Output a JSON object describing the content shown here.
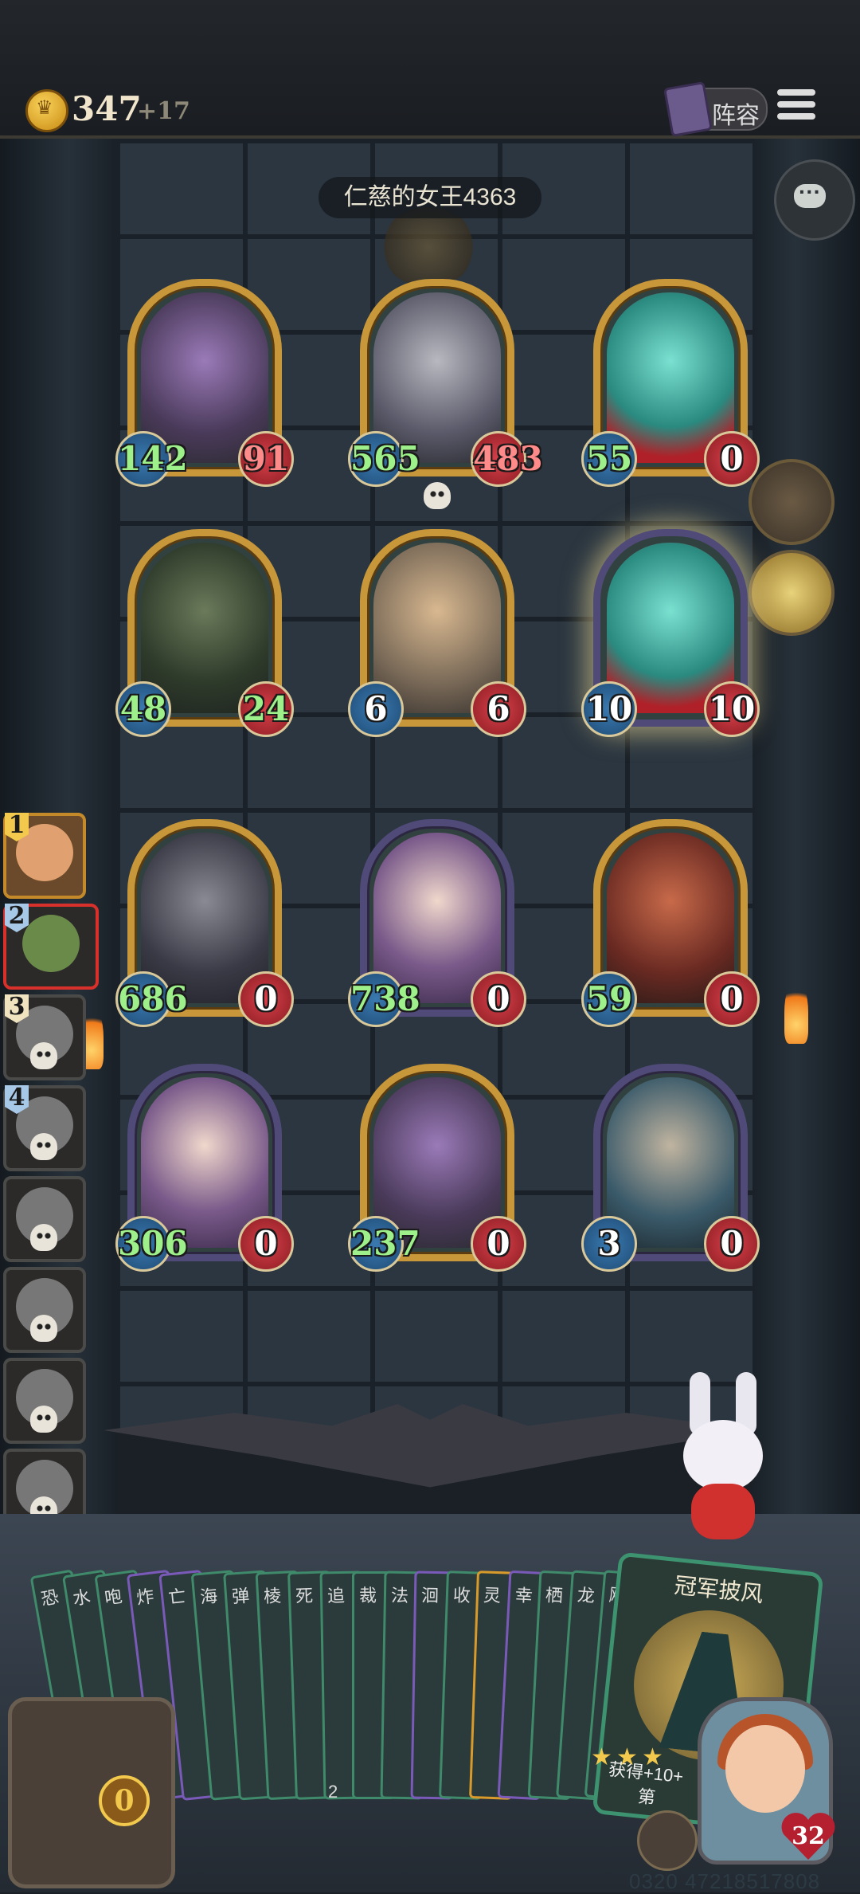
{
  "header": {
    "gold": "347",
    "gold_gain": "+17",
    "lineup_label": "阵容"
  },
  "opponent": {
    "name": "仁慈的女王4363"
  },
  "board": {
    "enemy": [
      {
        "atk": "142",
        "hp": "91",
        "frame": "gold",
        "art": "serpent-dragon"
      },
      {
        "atk": "565",
        "hp": "483",
        "frame": "gold",
        "art": "rhino-knight",
        "skull": true
      },
      {
        "atk": "55",
        "hp": "0",
        "frame": "gold",
        "art": "ghost-spirit"
      },
      {
        "atk": "48",
        "hp": "24",
        "frame": "gold",
        "art": "skull-necromancer"
      },
      {
        "atk": "6",
        "hp": "6",
        "frame": "gold",
        "art": "scribe"
      },
      {
        "atk": "10",
        "hp": "10",
        "frame": "purple",
        "art": "ghost-spirit",
        "glow": true
      }
    ],
    "player": [
      {
        "atk": "686",
        "hp": "0",
        "frame": "gold",
        "art": "shadow-dragon"
      },
      {
        "atk": "738",
        "hp": "0",
        "frame": "purple",
        "art": "monocle-granny"
      },
      {
        "atk": "59",
        "hp": "0",
        "frame": "gold",
        "art": "red-dragon"
      },
      {
        "atk": "306",
        "hp": "0",
        "frame": "purple",
        "art": "monocle-granny"
      },
      {
        "atk": "237",
        "hp": "0",
        "frame": "gold",
        "art": "serpent-dragon"
      },
      {
        "atk": "3",
        "hp": "0",
        "frame": "purple",
        "art": "blue-beast"
      }
    ]
  },
  "leaderboard": [
    {
      "rank": "1",
      "state": "first"
    },
    {
      "rank": "2",
      "state": "current"
    },
    {
      "rank": "3",
      "state": "dead"
    },
    {
      "rank": "4",
      "state": "dead"
    },
    {
      "rank": "",
      "state": "dead"
    },
    {
      "rank": "",
      "state": "dead"
    },
    {
      "rank": "",
      "state": "dead"
    },
    {
      "rank": "",
      "state": "dead"
    }
  ],
  "hand": {
    "card_names": [
      "恐",
      "水",
      "咆",
      "炸",
      "亡",
      "海",
      "弹",
      "棱",
      "死",
      "追",
      "裁",
      "法",
      "洄",
      "收",
      "灵",
      "幸",
      "栖",
      "龙",
      "飓"
    ],
    "featured": {
      "title": "冠军披风",
      "desc": "获得+10+",
      "desc2": "第",
      "stars": 3
    },
    "stray": "2"
  },
  "chest_count": "0",
  "hero_hp": "32",
  "footer_id": "0320 47218517808"
}
